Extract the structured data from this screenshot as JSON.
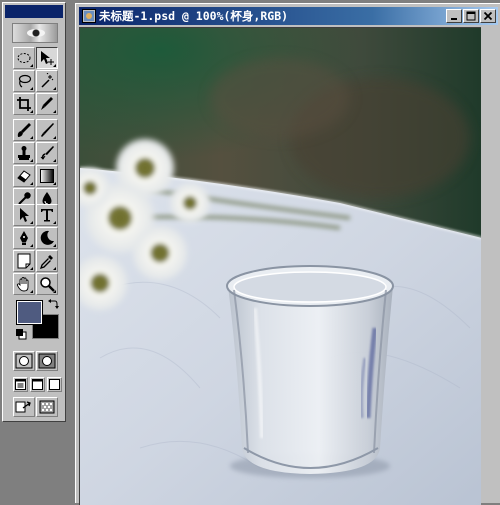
{
  "document_window": {
    "title": "未标题-1.psd @ 100%(杯身,RGB)"
  },
  "toolbox": {
    "tools": [
      {
        "name": "marquee-tool",
        "icon": "dashed-ellipse-icon"
      },
      {
        "name": "move-tool",
        "icon": "move-arrow-icon"
      },
      {
        "name": "lasso-tool",
        "icon": "lasso-icon"
      },
      {
        "name": "magic-wand-tool",
        "icon": "magic-wand-icon"
      },
      {
        "name": "crop-tool",
        "icon": "crop-icon"
      },
      {
        "name": "slice-tool",
        "icon": "knife-icon"
      },
      {
        "name": "healing-brush-tool",
        "icon": "brush-icon"
      },
      {
        "name": "brush-tool",
        "icon": "pencil-brush-icon"
      },
      {
        "name": "clone-stamp-tool",
        "icon": "stamp-icon"
      },
      {
        "name": "history-brush-tool",
        "icon": "history-brush-icon"
      },
      {
        "name": "eraser-tool",
        "icon": "eraser-icon"
      },
      {
        "name": "gradient-tool",
        "icon": "gradient-icon"
      },
      {
        "name": "dodge-tool",
        "icon": "dodge-icon"
      },
      {
        "name": "blur-tool",
        "icon": "drop-icon"
      },
      {
        "name": "path-selection-tool",
        "icon": "arrow-icon"
      },
      {
        "name": "type-tool",
        "icon": "type-icon"
      },
      {
        "name": "pen-tool",
        "icon": "pen-icon"
      },
      {
        "name": "shape-tool",
        "icon": "moon-shape-icon"
      },
      {
        "name": "notes-tool",
        "icon": "note-icon"
      },
      {
        "name": "eyedropper-tool",
        "icon": "eyedropper-icon"
      },
      {
        "name": "hand-tool",
        "icon": "hand-icon"
      },
      {
        "name": "zoom-tool",
        "icon": "zoom-icon"
      }
    ],
    "foreground_color": "#4f5b80",
    "background_color": "#000000"
  },
  "colors": {
    "titlebar": "#0a246a",
    "workspace": "#7f7f7f",
    "chrome": "#c0c0c0"
  }
}
